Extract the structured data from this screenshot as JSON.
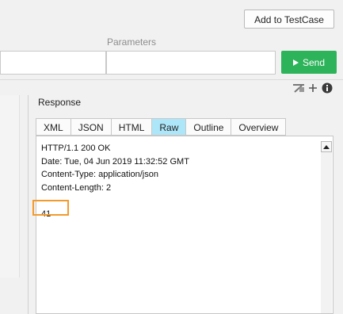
{
  "toolbar": {
    "add_to_testcase_label": "Add to TestCase"
  },
  "parameters": {
    "label": "Parameters",
    "send_label": "Send"
  },
  "response": {
    "title": "Response",
    "tabs": [
      "XML",
      "JSON",
      "HTML",
      "Raw",
      "Outline",
      "Overview"
    ],
    "active_tab": "Raw",
    "lines": [
      "HTTP/1.1 200 OK",
      "Date: Tue, 04 Jun 2019 11:32:52 GMT",
      "Content-Type: application/json",
      "Content-Length: 2",
      "",
      "41"
    ]
  },
  "icons": [
    "format-icon",
    "plus-icon",
    "info-icon",
    "play-icon",
    "scroll-up-arrow-icon"
  ],
  "colors": {
    "send_button": "#2db35a",
    "active_tab": "#aee6f9",
    "highlight_border": "#f39a2c"
  }
}
